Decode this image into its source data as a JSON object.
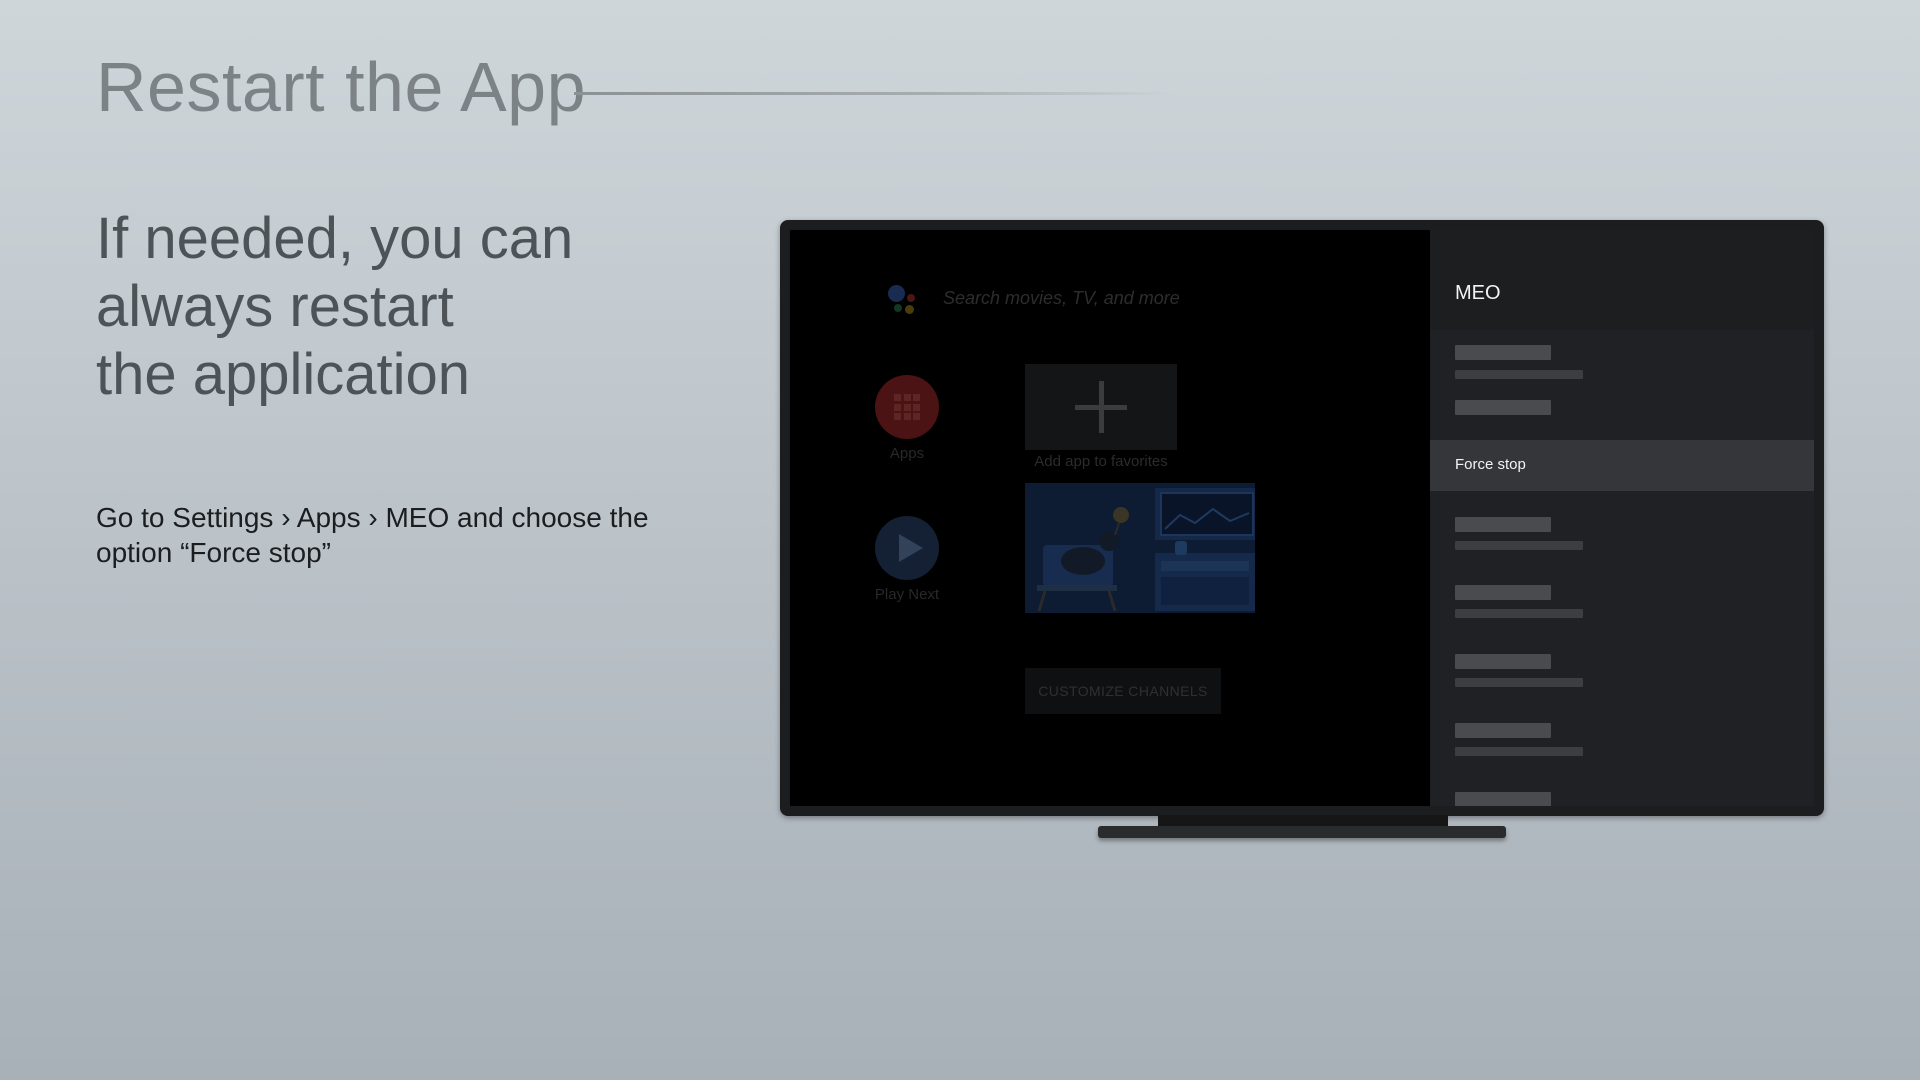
{
  "heading": "Restart the App",
  "lead_lines": [
    "If needed, you can",
    "always restart",
    "the application"
  ],
  "instruction": "Go to Settings › Apps › MEO and choose the option “Force stop”",
  "tv": {
    "search_placeholder": "Search movies, TV, and more",
    "apps_label": "Apps",
    "play_next_label": "Play Next",
    "add_favorites_label": "Add app to favorites",
    "customize_label": "CUSTOMIZE CHANNELS",
    "icons": [
      "google-assistant-icon",
      "apps-grid-icon",
      "play-icon",
      "plus-icon"
    ],
    "settings_panel": {
      "title": "MEO",
      "selected_item": "Force stop"
    }
  },
  "colors": {
    "apps_red": "#4b1313",
    "play_blue": "#142033",
    "panel_bg": "#202124",
    "selected_row": "#35363a"
  }
}
